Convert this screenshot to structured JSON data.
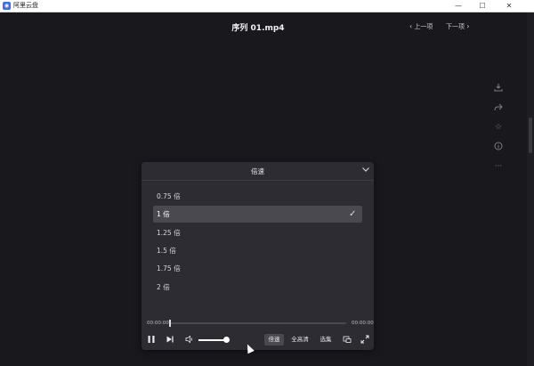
{
  "window": {
    "app_title": "阿里云盘",
    "minimize": "—",
    "maximize": "☐",
    "close": "✕"
  },
  "header": {
    "video_title": "序列 01.mp4",
    "prev_label": "上一项",
    "next_label": "下一项"
  },
  "sidebar_icons": [
    "download-icon",
    "share-icon",
    "star-icon",
    "info-icon",
    "more-icon"
  ],
  "speed_panel": {
    "title": "倍速",
    "options": [
      {
        "label": "0.75 倍",
        "selected": false
      },
      {
        "label": "1 倍",
        "selected": true
      },
      {
        "label": "1.25 倍",
        "selected": false
      },
      {
        "label": "1.5 倍",
        "selected": false
      },
      {
        "label": "1.75 倍",
        "selected": false
      },
      {
        "label": "2 倍",
        "selected": false
      }
    ]
  },
  "player": {
    "current_time": "00:00:00",
    "total_time": "00:00:00",
    "progress": 0,
    "volume": 0.85,
    "speed_label": "倍速",
    "quality_label": "全高清",
    "episodes_label": "选集"
  }
}
